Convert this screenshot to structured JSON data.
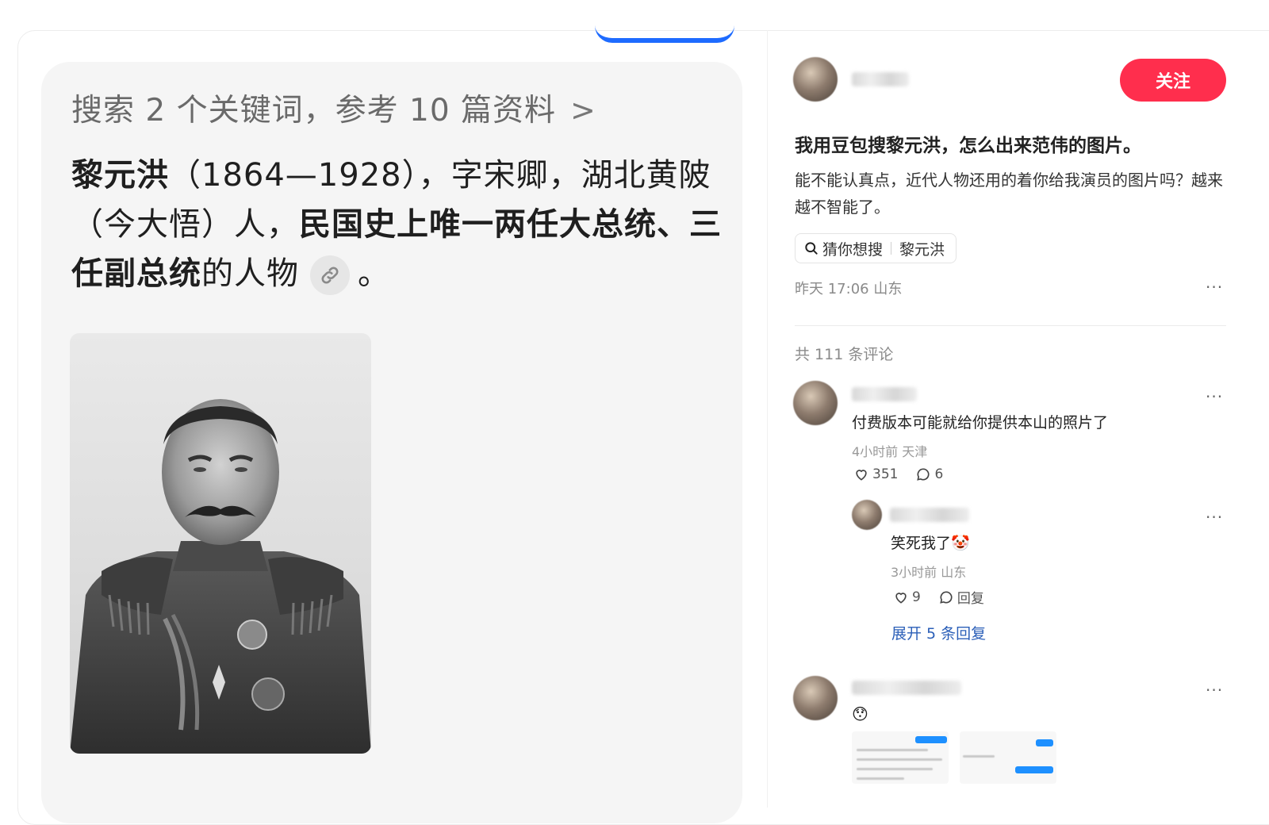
{
  "note": {
    "search_summary": "搜索 2 个关键词，参考 10 篇资料",
    "chevron": ">",
    "answer_bold_name": "黎元洪",
    "answer_part1": "（1864—1928），字宋卿，湖北黄陂（今大悟）人，",
    "answer_bold_part": "民国史上唯一两任大总统、三任副总统",
    "answer_part2": "的人物",
    "answer_end": "。",
    "link_icon": "link-icon",
    "image_icon": "portrait-photo"
  },
  "post": {
    "follow_label": "关注",
    "title": "我用豆包搜黎元洪，怎么出来范伟的图片。",
    "body": "能不能认真点，近代人物还用的着你给我演员的图片吗？越来越不智能了。",
    "tag_prefix": "猜你想搜",
    "tag_term": "黎元洪",
    "meta": "昨天 17:06 山东",
    "more": "···",
    "comment_count": "共 111 条评论"
  },
  "comments": [
    {
      "text": "付费版本可能就给你提供本山的照片了",
      "time": "4小时前 天津",
      "likes": "351",
      "replies": "6",
      "more": "···",
      "reply": {
        "text": "笑死我了",
        "emoji": "🤡",
        "time": "3小时前 山东",
        "likes": "9",
        "reply_label": "回复",
        "more": "···"
      },
      "expand_label": "展开 5 条回复"
    },
    {
      "emoji": "😯",
      "more": "···"
    }
  ],
  "colors": {
    "accent_red": "#ff2e4d",
    "link_blue": "#2b5fb8",
    "top_bar_blue": "#1e6bff"
  }
}
